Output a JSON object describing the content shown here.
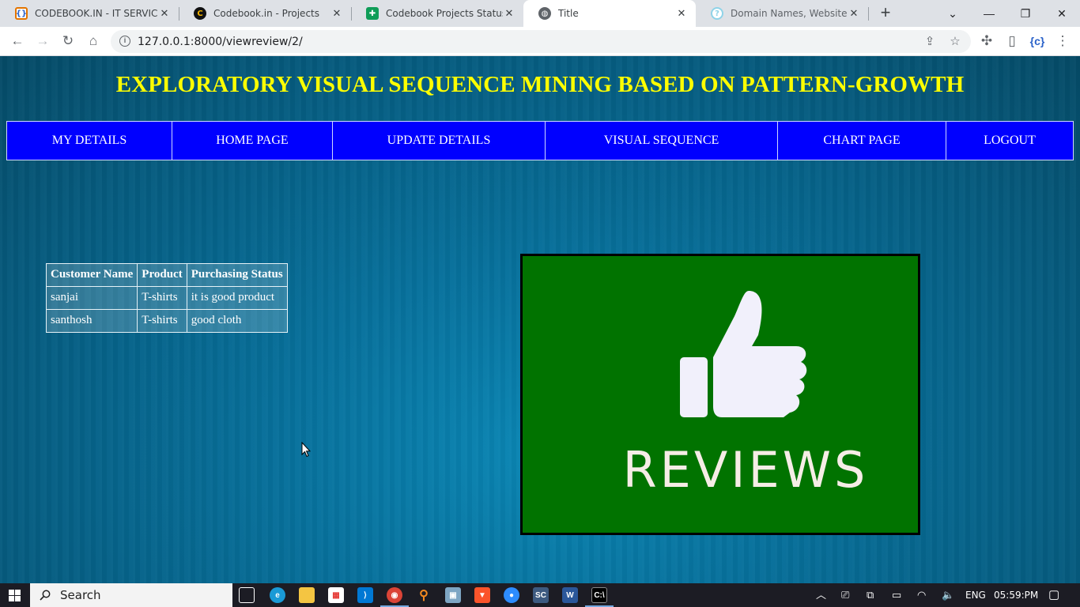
{
  "browser": {
    "tabs": [
      {
        "title": "CODEBOOK.IN - IT SERVICES",
        "icon": "codebook-favicon",
        "active": false
      },
      {
        "title": "Codebook.in - Projects",
        "icon": "codebook-c-favicon",
        "active": false
      },
      {
        "title": "Codebook Projects Status Re",
        "icon": "sheets-favicon",
        "active": false
      },
      {
        "title": "Title",
        "icon": "globe-favicon",
        "active": true
      },
      {
        "title": "Domain Names, Websites, Ho",
        "icon": "hostinger-favicon",
        "active": false
      }
    ],
    "url": "127.0.0.1:8000/viewreview/2/"
  },
  "page": {
    "headline": "EXPLORATORY VISUAL SEQUENCE MINING BASED ON PATTERN-GROWTH",
    "nav": [
      "MY DETAILS",
      "HOME PAGE",
      "UPDATE DETAILS",
      "VISUAL SEQUENCE",
      "CHART PAGE",
      "LOGOUT"
    ],
    "table": {
      "headers": [
        "Customer Name",
        "Product",
        "Purchasing Status"
      ],
      "rows": [
        [
          "sanjai",
          "T-shirts",
          "it is good product"
        ],
        [
          "santhosh",
          "T-shirts",
          "good cloth"
        ]
      ]
    },
    "review_image": {
      "text": "REVIEWS",
      "background": "#017300"
    }
  },
  "taskbar": {
    "search_placeholder": "Search",
    "language": "ENG",
    "time": "05:59:PM"
  },
  "colors": {
    "headline": "#ffff00",
    "nav_bg": "#0000ff",
    "page_bg": "#0a7aa5"
  }
}
